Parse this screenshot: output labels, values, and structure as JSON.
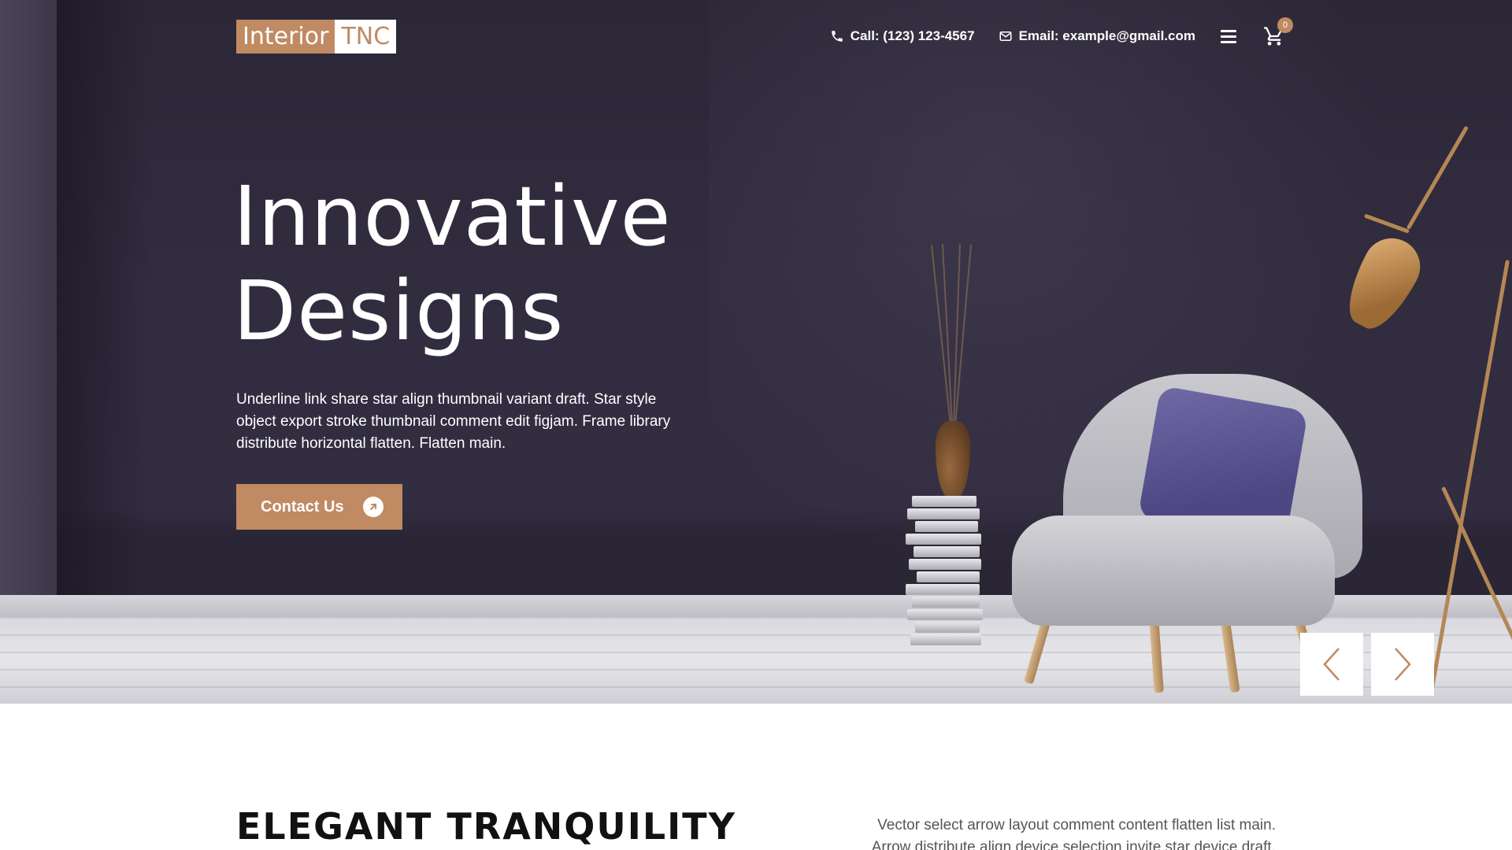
{
  "brand": {
    "logo_part1": "Interior",
    "logo_part2": "TNC",
    "accent_color": "#c08a62"
  },
  "header": {
    "phone": "Call: (123) 123-4567",
    "email": "Email: example@gmail.com",
    "phone_icon": "phone-icon",
    "email_icon": "mail-icon",
    "menu_icon": "hamburger-menu-icon",
    "cart_icon": "cart-icon",
    "cart_count": "0"
  },
  "hero": {
    "title_line1": "Innovative",
    "title_line2": "Designs",
    "description": "Underline link share star align thumbnail variant draft. Star style object export stroke thumbnail comment edit figjam. Frame library distribute horizontal flatten. Flatten main.",
    "cta_label": "Contact Us",
    "cta_icon": "arrow-up-right-icon",
    "prev_icon": "chevron-left-icon",
    "next_icon": "chevron-right-icon"
  },
  "section": {
    "title": "ELEGANT TRANQUILITY",
    "text": "Vector select arrow layout comment content flatten list main. Arrow distribute align device selection invite star device draft."
  }
}
